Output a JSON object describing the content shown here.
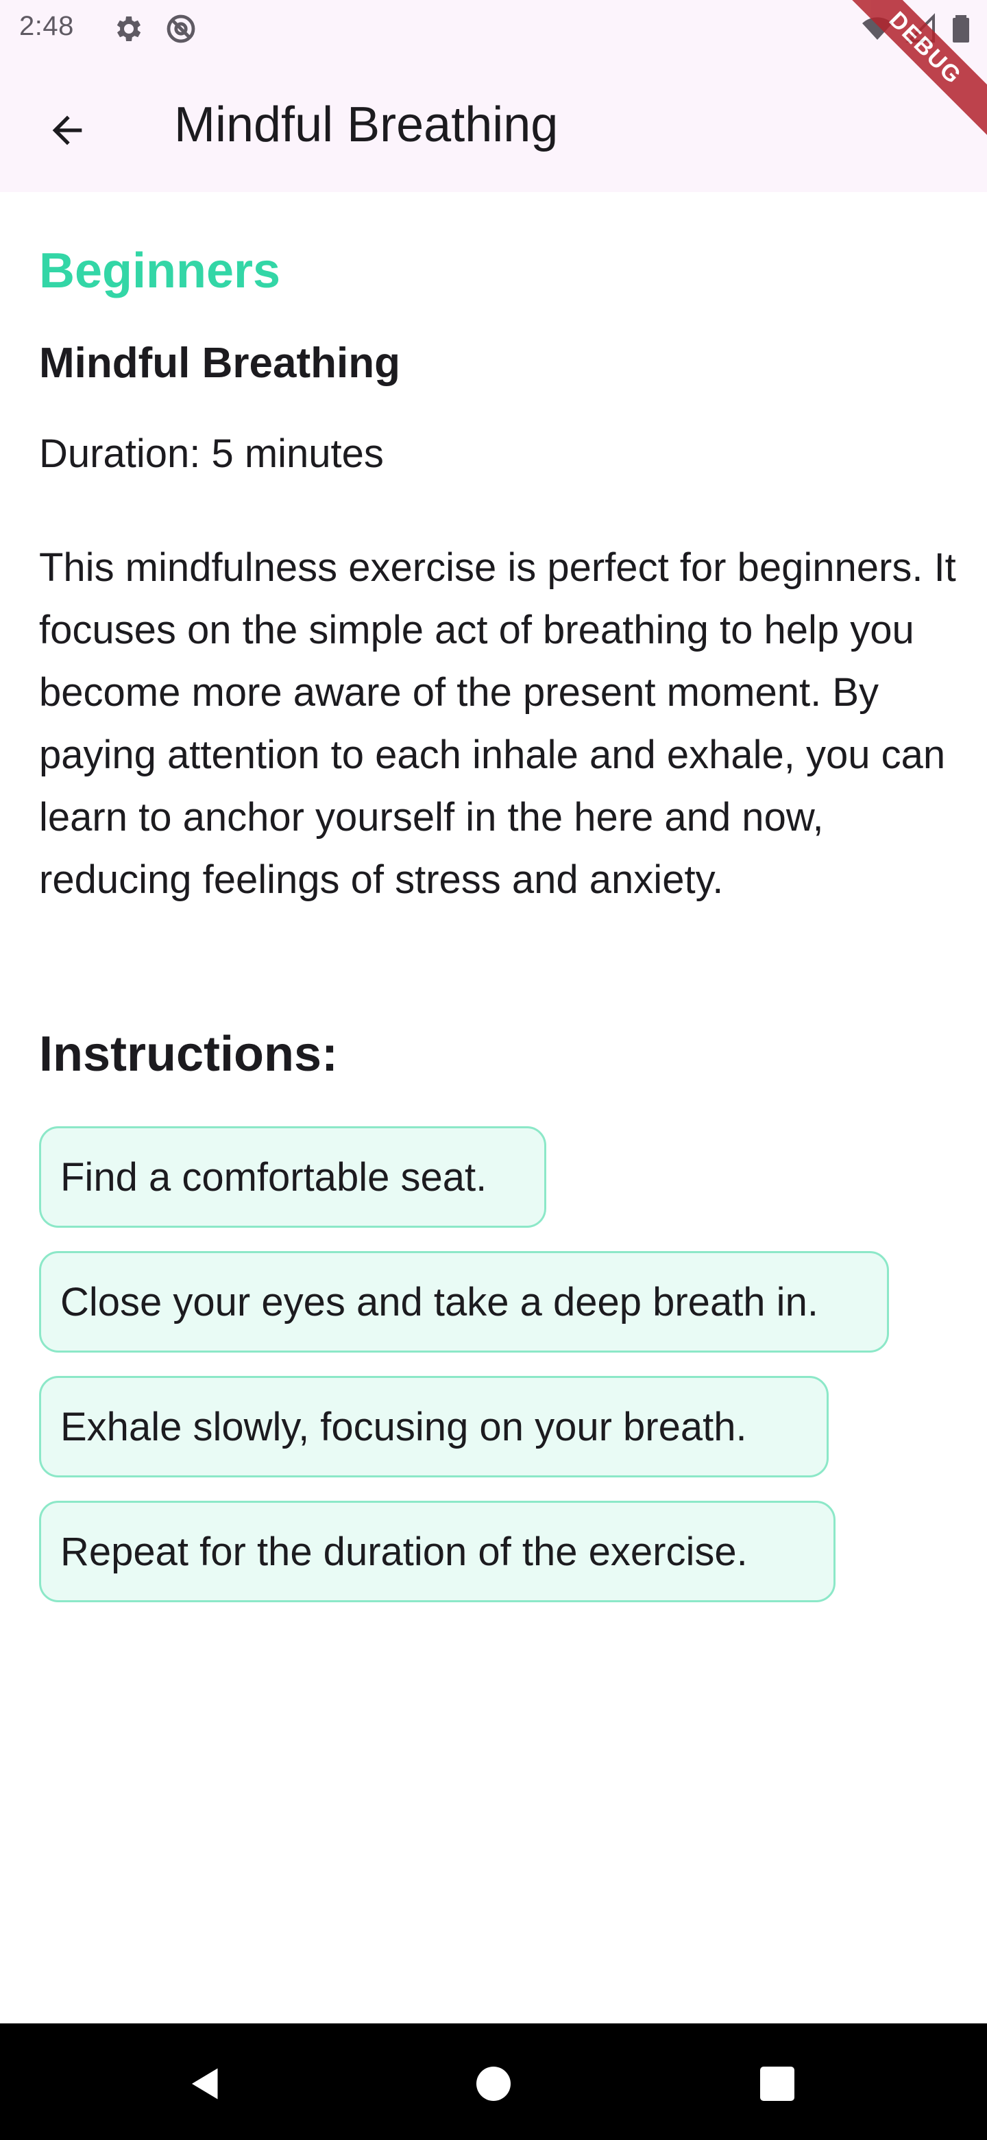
{
  "status_bar": {
    "time": "2:48",
    "icons": [
      "gear-icon",
      "at-sign-icon",
      "wifi-icon",
      "signal-icon",
      "battery-icon"
    ]
  },
  "app_bar": {
    "back_icon": "arrow-left-icon",
    "title": "Mindful Breathing"
  },
  "debug_banner": "DEBUG",
  "exercise": {
    "category": "Beginners",
    "title": "Mindful Breathing",
    "duration": "Duration: 5 minutes",
    "description": "This mindfulness exercise is perfect for beginners. It focuses on the simple act of breathing to help you become more aware of the present moment. By paying attention to each inhale and exhale, you can learn to anchor yourself in the here and now, reducing feelings of stress and anxiety.",
    "instructions_heading": "Instructions:",
    "steps": [
      "Find a comfortable seat.",
      "Close your eyes and take a deep breath in.",
      "Exhale slowly, focusing on your breath.",
      "Repeat for the duration of the exercise."
    ]
  },
  "nav_bar": {
    "icons": [
      "back-triangle-icon",
      "home-circle-icon",
      "recents-square-icon"
    ]
  },
  "colors": {
    "accent": "#33d6a6",
    "chip_background": "#e9fbf5",
    "chip_border": "#8ce8c8",
    "app_bar_background": "#fcf4fc"
  }
}
